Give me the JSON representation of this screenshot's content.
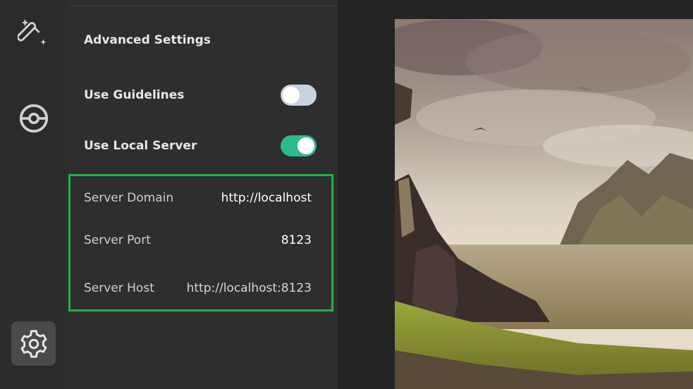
{
  "sidebar": {
    "items": [
      {
        "name": "magic-wand",
        "icon": "magic-wand-icon"
      },
      {
        "name": "pokeball",
        "icon": "pokeball-icon"
      },
      {
        "name": "settings",
        "icon": "gear-icon",
        "active": true
      }
    ]
  },
  "settings": {
    "title": "Advanced Settings",
    "use_guidelines": {
      "label": "Use Guidelines",
      "enabled": false
    },
    "use_local_server": {
      "label": "Use Local Server",
      "enabled": true
    },
    "server": {
      "domain_label": "Server Domain",
      "domain_value": "http://localhost",
      "port_label": "Server Port",
      "port_value": "8123",
      "host_label": "Server Host",
      "host_value": "http://localhost:8123"
    }
  },
  "colors": {
    "toggle_on": "#2dba8c",
    "toggle_off": "#c9d2e0",
    "highlight_box": "#22b14c"
  }
}
